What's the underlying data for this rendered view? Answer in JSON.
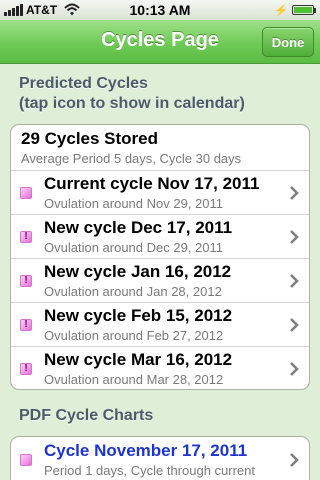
{
  "status_bar": {
    "carrier": "AT&T",
    "time": "10:13 AM"
  },
  "nav": {
    "title": "Cycles Page",
    "done_label": "Done"
  },
  "predicted_section": {
    "header_line1": "Predicted Cycles",
    "header_line2": "(tap icon to show in calendar)",
    "summary_title": "29 Cycles Stored",
    "summary_sub": "Average Period 5 days, Cycle 30 days",
    "items": [
      {
        "title": "Current cycle Nov 17, 2011",
        "sub": "Ovulation around Nov 29, 2011",
        "icon": "calendar-square-icon",
        "mark": ""
      },
      {
        "title": "New cycle Dec 17, 2011",
        "sub": "Ovulation around Dec 29, 2011",
        "icon": "calendar-exclaim-icon",
        "mark": "!"
      },
      {
        "title": "New cycle Jan 16, 2012",
        "sub": "Ovulation around Jan 28, 2012",
        "icon": "calendar-exclaim-icon",
        "mark": "!"
      },
      {
        "title": "New cycle Feb 15, 2012",
        "sub": "Ovulation around Feb 27, 2012",
        "icon": "calendar-exclaim-icon",
        "mark": "!"
      },
      {
        "title": "New cycle Mar 16, 2012",
        "sub": "Ovulation around Mar 28, 2012",
        "icon": "calendar-exclaim-icon",
        "mark": "!"
      }
    ]
  },
  "pdf_section": {
    "header": "PDF Cycle Charts",
    "items": [
      {
        "title": "Cycle November 17, 2011",
        "sub": "Period 1 days, Cycle through current",
        "icon": "calendar-square-icon"
      }
    ]
  },
  "colors": {
    "nav_green": "#6fcb55",
    "background": "#dfeed6",
    "link_blue": "#1c34d4",
    "icon_pink": "#e36fd8"
  }
}
